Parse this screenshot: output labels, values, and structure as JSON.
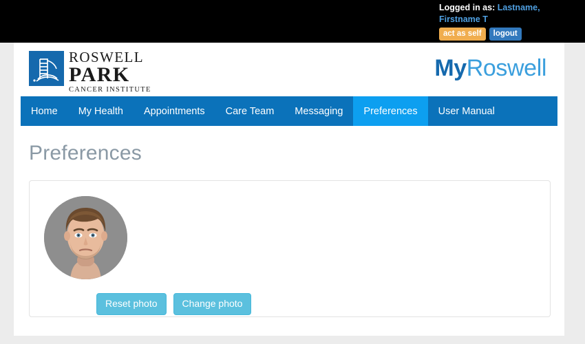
{
  "topbar": {
    "logged_in_label": "Logged in as:",
    "user_name_line1": "Lastname,",
    "user_name_line2": "Firstname T",
    "act_as_self_label": "act as self",
    "logout_label": "logout",
    "background_color": "#000000",
    "user_name_color": "#4f9fe0",
    "act_as_self_color": "#f0ad4e",
    "logout_color": "#3279bd"
  },
  "brand": {
    "logo_line1": "ROSWELL",
    "logo_line2": "PARK",
    "logo_line3": "CANCER INSTITUTE",
    "logo_mark_color": "#1569ad",
    "app_name_prefix": "My",
    "app_name_suffix": "Roswell",
    "app_name_prefix_color": "#1569ad",
    "app_name_suffix_color": "#3b9fdd"
  },
  "nav": {
    "background_color": "#0b72ba",
    "active_color": "#0d9ff0",
    "items": [
      {
        "label": "Home",
        "active": false
      },
      {
        "label": "My Health",
        "active": false
      },
      {
        "label": "Appointments",
        "active": false
      },
      {
        "label": "Care Team",
        "active": false
      },
      {
        "label": "Messaging",
        "active": false
      },
      {
        "label": "Preferences",
        "active": true
      },
      {
        "label": "User Manual",
        "active": false
      }
    ]
  },
  "main": {
    "page_title": "Preferences",
    "page_title_color": "#8a99a5",
    "photo_panel": {
      "avatar_alt": "user-profile-photo",
      "avatar_background_color": "#8e8e8e",
      "reset_photo_label": "Reset photo",
      "change_photo_label": "Change photo",
      "button_color": "#5bc0de"
    }
  }
}
